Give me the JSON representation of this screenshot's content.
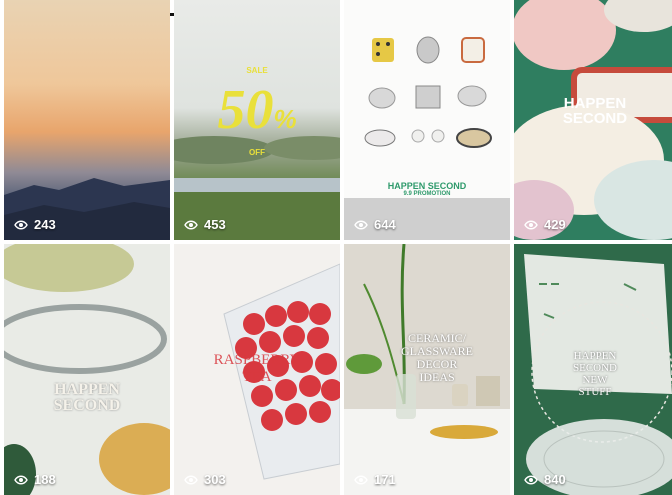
{
  "posts": [
    {
      "views": "243"
    },
    {
      "views": "453",
      "sale_label": "SALE",
      "percent": "50",
      "percent_sign": "%",
      "off_label": "OFF"
    },
    {
      "views": "644",
      "title": "HAPPEN SECOND",
      "subtitle": "9.9 PROMOTION"
    },
    {
      "views": "429",
      "title_line1": "HAPPEN",
      "title_line2": "SECOND"
    },
    {
      "views": "188",
      "title_line1": "HAPPEN",
      "title_line2": "SECOND"
    },
    {
      "views": "303",
      "title_line1": "RASPBERRY",
      "title_line2": "TEA"
    },
    {
      "views": "171",
      "line1": "CERAMIC/",
      "line2": "GLASSWARE",
      "line3": "DECOR",
      "line4": "IDEAS"
    },
    {
      "views": "840",
      "line1": "HAPPEN",
      "line2": "SECOND",
      "line3": "NEW",
      "line4": "STUFF"
    }
  ],
  "icons": {
    "views": "eye-icon"
  },
  "colors": {
    "sale_yellow": "#e9e03a",
    "brand_green": "#2e9a6b"
  }
}
